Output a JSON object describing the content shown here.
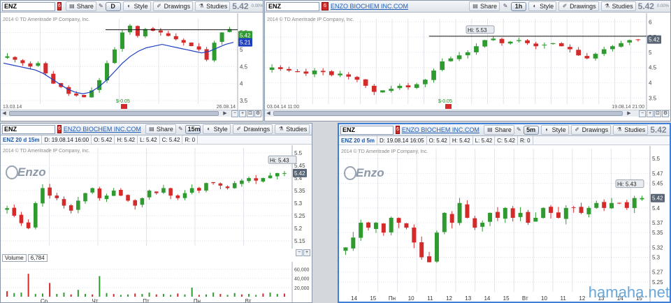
{
  "colors": {
    "up": "#2f9a2f",
    "down": "#d42a2a",
    "grid": "#e0e4ea",
    "resistance": "#111111",
    "ma": "#1e3fc4",
    "accent": "#3f7fd6"
  },
  "labels": {
    "share": "Share",
    "style": "Style",
    "drawings": "Drawings",
    "studies": "Studies",
    "price": "5.42",
    "pct": "0.00%",
    "company": "ENZO BIOCHEM INC.COM",
    "symbol": "ENZ",
    "badge": "6"
  },
  "panes": {
    "tl": {
      "symbol": "ENZ",
      "timeframe": "D",
      "copyright": "2014 © TD Ameritrade IP Company, Inc.",
      "last_label": "5.42",
      "ma_label": "5.21",
      "date_start": "13.03.14",
      "date_end": "26.08.14",
      "div_label": "$-0.05",
      "yticks": [
        "5.5",
        "5",
        "4.5",
        "4",
        "3.5"
      ]
    },
    "tr": {
      "symbol": "ENZ",
      "timeframe": "1h",
      "copyright": "2014 © TD Ameritrade IP Company, Inc.",
      "last_label": "5.42",
      "hi_label": "Hi: 5.53",
      "date_start": "03.04.14 11:00",
      "date_end": "19.08.14 21:00",
      "div_label": "$-0.05",
      "yticks": [
        "6",
        "5.5",
        "5",
        "4.5",
        "4",
        "3.5"
      ]
    },
    "bl": {
      "symbol": "ENZ",
      "timeframe": "15m",
      "copyright": "2014 © TD Ameritrade IP Company, Inc.",
      "info": {
        "title": "ENZ 20 d 15m",
        "date": "D: 19.08.14 16:00",
        "o": "O: 5.42",
        "h": "H: 5.42",
        "l": "L: 5.42",
        "c": "C: 5.42",
        "r": "R: 0"
      },
      "logo": "Enzo",
      "last_label": "5.42",
      "hi_label": "Hi: 5.43",
      "yticks": [
        "5.5",
        "5.45",
        "5.4",
        "5.35",
        "5.3",
        "5.25",
        "5.2",
        "5.15"
      ],
      "volume": {
        "label": "Volume",
        "value": "6,784",
        "yticks": [
          "60,000",
          "40,000",
          "20,000"
        ]
      },
      "xticks": [
        "Ср",
        "Чт",
        "Пт",
        "Пн",
        "Вт"
      ]
    },
    "br": {
      "symbol": "ENZ",
      "timeframe": "5m",
      "copyright": "2014 © TD Ameritrade IP Company, Inc.",
      "info": {
        "title": "ENZ 20 d 5m",
        "date": "D: 19.08.14 16:05",
        "o": "O: 5.42",
        "h": "H: 5.42",
        "l": "L: 5.42",
        "c": "C: 5.42",
        "r": "R: 0"
      },
      "logo": "Enzo",
      "last_label": "5.42",
      "hi_label": "Hi: 5.43",
      "yticks": [
        "5.5",
        "5.47",
        "5.45",
        "5.42",
        "5.4",
        "5.37",
        "5.35",
        "5.32",
        "5.3",
        "5.27",
        "5.25"
      ],
      "xticks": [
        "14",
        "15",
        "Пн",
        "10",
        "11",
        "12",
        "13",
        "14",
        "15",
        "Вт",
        "10",
        "11",
        "12",
        "13",
        "14",
        "15"
      ]
    }
  },
  "watermark": "hamaha.net",
  "chart_data": [
    {
      "type": "candlestick",
      "title": "ENZ D",
      "ylim": [
        3.4,
        5.9
      ],
      "last": 5.42,
      "ma": [
        4.6,
        4.55,
        4.5,
        4.45,
        4.4,
        4.3,
        4.15,
        4.0,
        3.85,
        3.75,
        3.7,
        3.75,
        3.9,
        4.1,
        4.35,
        4.6,
        4.8,
        4.95,
        5.05,
        5.1,
        5.15,
        5.1,
        5.05,
        5.0,
        4.95,
        4.9,
        4.95,
        5.05,
        5.15,
        5.21
      ],
      "closes": [
        4.8,
        4.7,
        4.6,
        4.5,
        4.6,
        4.3,
        4.0,
        3.9,
        3.7,
        3.65,
        3.6,
        3.8,
        4.1,
        4.6,
        5.0,
        5.5,
        5.7,
        5.4,
        5.6,
        5.55,
        5.5,
        5.4,
        5.3,
        5.2,
        5.1,
        5.0,
        4.7,
        5.2,
        5.5,
        5.6
      ]
    },
    {
      "type": "candlestick",
      "title": "ENZ 1h",
      "ylim": [
        3.3,
        6.1
      ],
      "last": 5.42,
      "resistance": 5.53,
      "closes": [
        4.5,
        4.45,
        4.4,
        4.35,
        4.3,
        4.4,
        4.35,
        4.25,
        4.3,
        4.2,
        4.1,
        3.9,
        3.7,
        3.75,
        3.8,
        3.9,
        3.85,
        3.95,
        4.1,
        4.4,
        4.7,
        4.8,
        4.9,
        5.0,
        5.2,
        5.4,
        5.45,
        5.3,
        5.35,
        5.4,
        5.3,
        5.2,
        5.25,
        5.3,
        5.2,
        5.1,
        4.9,
        4.8,
        4.95,
        5.1,
        5.2,
        5.3,
        5.4,
        5.42
      ]
    },
    {
      "type": "candlestick",
      "title": "ENZ 20 d 15m",
      "ylim": [
        5.13,
        5.52
      ],
      "last": 5.42,
      "hi": 5.43,
      "closes": [
        5.28,
        5.25,
        5.22,
        5.2,
        5.3,
        5.36,
        5.33,
        5.32,
        5.29,
        5.27,
        5.31,
        5.34,
        5.36,
        5.32,
        5.33,
        5.35,
        5.33,
        5.31,
        5.29,
        5.32,
        5.35,
        5.34,
        5.36,
        5.33,
        5.32,
        5.34,
        5.36,
        5.35,
        5.38,
        5.38,
        5.37,
        5.36,
        5.38,
        5.39,
        5.4,
        5.39,
        5.4,
        5.41,
        5.42,
        5.42
      ],
      "volume": [
        12000,
        8000,
        9000,
        50000,
        6000,
        7000,
        30000,
        6000,
        9000,
        5000,
        15000,
        6000,
        5000,
        45000,
        8000,
        6000,
        4000,
        5000,
        7000,
        6000,
        9000,
        5000,
        6000,
        4000,
        7000,
        5000,
        20000,
        4000,
        5000,
        9000,
        6000,
        4000,
        8000,
        5000,
        6000,
        4000,
        7000,
        9000,
        6000,
        6784
      ]
    },
    {
      "type": "candlestick",
      "title": "ENZ 20 d 5m",
      "ylim": [
        5.23,
        5.52
      ],
      "last": 5.42,
      "hi": 5.43,
      "closes": [
        5.32,
        5.34,
        5.37,
        5.36,
        5.37,
        5.35,
        5.38,
        5.37,
        5.36,
        5.33,
        5.3,
        5.29,
        5.35,
        5.39,
        5.37,
        5.41,
        5.38,
        5.36,
        5.37,
        5.39,
        5.38,
        5.4,
        5.38,
        5.39,
        5.37,
        5.38,
        5.4,
        5.39,
        5.38,
        5.4,
        5.4,
        5.39,
        5.4,
        5.41,
        5.4,
        5.41,
        5.41,
        5.4,
        5.42,
        5.42
      ]
    }
  ]
}
